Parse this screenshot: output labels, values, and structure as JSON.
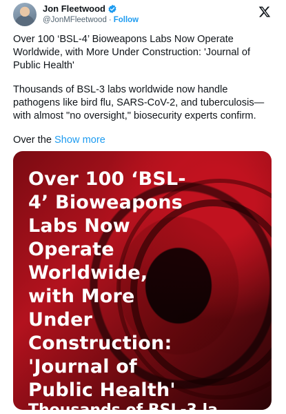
{
  "author": {
    "name": "Jon Fleetwood",
    "handle": "@JonMFleetwood",
    "separator": "·",
    "follow_label": "Follow"
  },
  "tweet": {
    "paragraph1": "Over 100 ‘BSL-4’ Bioweapons Labs Now Operate Worldwide, with More Under Construction: 'Journal of Public Health'",
    "paragraph2": "Thousands of BSL-3 labs worldwide now handle pathogens like bird flu, SARS-CoV-2, and tuberculosis—with almost \"no oversight,\" biosecurity experts confirm.",
    "paragraph3_prefix": "Over the ",
    "show_more": "Show more"
  },
  "media": {
    "headline_lines": [
      "Over 100 ‘BSL-",
      "4’ Bioweapons",
      "Labs Now",
      "Operate",
      "Worldwide,",
      "with More",
      "Under",
      "Construction:",
      "'Journal of",
      "Public Health'"
    ],
    "cut_off_text": "Thousands of BSL-3 la"
  },
  "colors": {
    "accent": "#1d9bf0",
    "text": "#0f1419",
    "muted": "#536471",
    "media_red": "#b3121e"
  },
  "icons": {
    "verified": "verified-badge-icon",
    "platform": "x-logo-icon"
  }
}
